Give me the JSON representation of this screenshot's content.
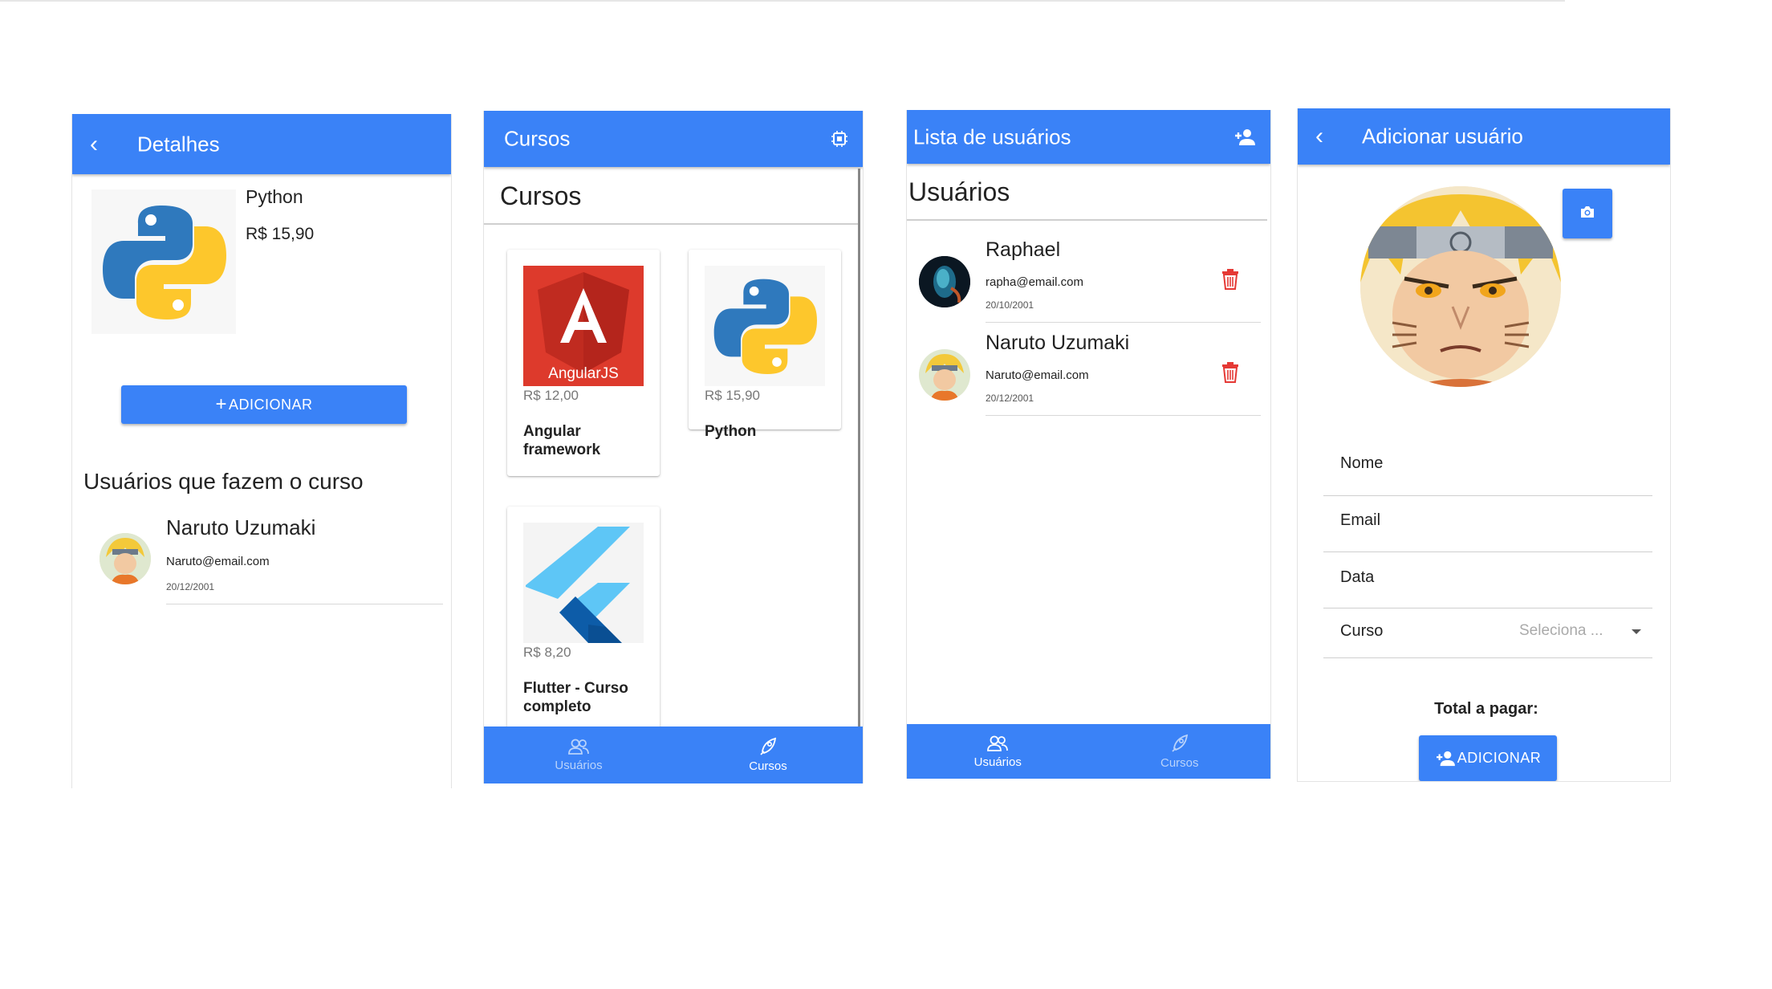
{
  "details": {
    "title": "Detalhes",
    "course_name": "Python",
    "course_price": "R$ 15,90",
    "add_label": "ADICIONAR",
    "add_plus": "+",
    "users_heading": "Usuários que fazem o curso",
    "users": [
      {
        "name": "Naruto Uzumaki",
        "email": "Naruto@email.com",
        "date": "20/12/2001"
      }
    ]
  },
  "courses": {
    "title": "Cursos",
    "heading": "Cursos",
    "items": [
      {
        "price": "R$ 12,00",
        "name": "Angular framework",
        "logo_text": "AngularJS",
        "logo_letter": "A",
        "image": "angular-logo"
      },
      {
        "price": "R$ 15,90",
        "name": "Python",
        "image": "python-logo"
      },
      {
        "price": "R$ 8,20",
        "name": "Flutter - Curso completo",
        "image": "flutter-logo"
      }
    ],
    "nav": [
      {
        "label": "Usuários",
        "icon": "people-icon",
        "active": false
      },
      {
        "label": "Cursos",
        "icon": "rocket-icon",
        "active": true
      }
    ]
  },
  "users_list": {
    "title": "Lista de usuários",
    "heading": "Usuários",
    "users": [
      {
        "name": "Raphael",
        "email": "rapha@email.com",
        "date": "20/10/2001"
      },
      {
        "name": "Naruto Uzumaki",
        "email": "Naruto@email.com",
        "date": "20/12/2001"
      }
    ],
    "nav": [
      {
        "label": "Usuários",
        "icon": "people-icon",
        "active": true
      },
      {
        "label": "Cursos",
        "icon": "rocket-icon",
        "active": false
      }
    ]
  },
  "add_user": {
    "title": "Adicionar usuário",
    "fields": {
      "nome": "Nome",
      "email": "Email",
      "data": "Data",
      "curso": "Curso"
    },
    "curso_placeholder": "Seleciona ...",
    "total_label": "Total a pagar:",
    "add_label": "ADICIONAR"
  },
  "colors": {
    "primary": "#3a82f7",
    "delete": "#e53935"
  }
}
